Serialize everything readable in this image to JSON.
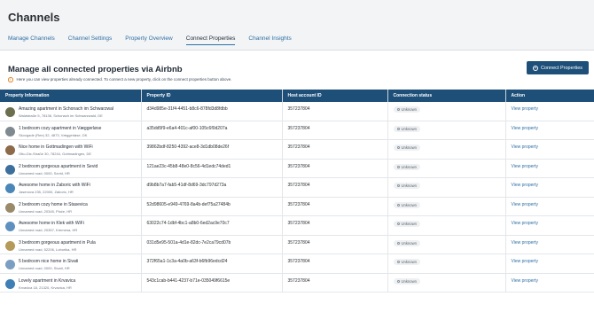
{
  "header": {
    "title": "Channels",
    "tabs": [
      {
        "label": "Manage Channels",
        "active": false
      },
      {
        "label": "Channel Settings",
        "active": false
      },
      {
        "label": "Property Overview",
        "active": false
      },
      {
        "label": "Connect Properties",
        "active": true
      },
      {
        "label": "Channel Insights",
        "active": false
      }
    ]
  },
  "section": {
    "title": "Manage all connected properties via Airbnb",
    "connect_button": "Connect Properties",
    "info": "Here you can view properties already connected. To connect a new property, click on the connect properties button above."
  },
  "table": {
    "columns": [
      "Property Information",
      "Property ID",
      "Host account ID",
      "Connection status",
      "Action"
    ],
    "rows": [
      {
        "name": "Amazing apartment in Schonach im Schwarzwal",
        "address": "Waldstraße 5, 78136, Schonach im Schwarzwald, DE",
        "property_id": "d34d985e-31f4-4451-b8c6-878fd3d8fdbb",
        "host_id": "357237804",
        "status": "Unknown",
        "action": "View property",
        "thumb": "#6b6f4e"
      },
      {
        "name": "1 bedroom cozy apartment in Væggerløse",
        "address": "Skovgade (Ree) 32, 4873, Væggerløse, DK",
        "property_id": "a35dd5f9-e6a4-401c-af00-105c6f0d207a",
        "host_id": "357237804",
        "status": "Unknown",
        "action": "View property",
        "thumb": "#7e8a8f"
      },
      {
        "name": "Nice home in Gottmadingen with WiFi",
        "address": "Otto-Dix-Straße 30, 78244, Gottmadingen, DE",
        "property_id": "39862bdf-8250-4392-ace8-3d1db08de26f",
        "host_id": "357237804",
        "status": "Unknown",
        "action": "View property",
        "thumb": "#8c6a4a"
      },
      {
        "name": "2 bedroom gorgeous apartment in Sevid",
        "address": "Unnamed road, 0000, Sevid, HR",
        "property_id": "121ae23c-45b8-48e0-8c56-4d1edc74ded1",
        "host_id": "357237804",
        "status": "Unknown",
        "action": "View property",
        "thumb": "#3d6f9c"
      },
      {
        "name": "Awesome home in Zaboric with WiFi",
        "address": "Jasenova 235, 22000, Zaboric, HR",
        "property_id": "d9b8b7a7-fab5-41df-8d69-3dc797d273a",
        "host_id": "357237804",
        "status": "Unknown",
        "action": "View property",
        "thumb": "#4a86b8"
      },
      {
        "name": "2 bedroom cozy home in Stasevica",
        "address": "Unnamed road, 20345, Ploče, HR",
        "property_id": "52d98605-e949-4769-8a4b-def75a27484b",
        "host_id": "357237804",
        "status": "Unknown",
        "action": "View property",
        "thumb": "#9a8a6a"
      },
      {
        "name": "Awesome home in Klek with WiFi",
        "address": "Unnamed road, 20357, Kremena, HR",
        "property_id": "63022c74-1dbf-4bc1-a8b0-6ed2ac9e70c7",
        "host_id": "357237804",
        "status": "Unknown",
        "action": "View property",
        "thumb": "#5f90bf"
      },
      {
        "name": "3 bedroom gorgeous apartment in Pula",
        "address": "Unnamed road, 52206, Loborika, HR",
        "property_id": "031d5e95-501a-4d1e-82dc-7e2ca79cd07b",
        "host_id": "357237804",
        "status": "Unknown",
        "action": "View property",
        "thumb": "#b59a5a"
      },
      {
        "name": "5 bedroom nice home in Sivati",
        "address": "Unnamed road, 0000, Sivati, HR",
        "property_id": "372f65a1-1c3a-4a0b-a63f-b6fb96edcd24",
        "host_id": "357237804",
        "status": "Unknown",
        "action": "View property",
        "thumb": "#7a9fc2"
      },
      {
        "name": "Lovely apartment in Krvavica",
        "address": "Krvavica 18, 21320, Krvavica, HR",
        "property_id": "543c1cab-b441-4237-b71e-035049f6615e",
        "host_id": "357237804",
        "status": "Unknown",
        "action": "View property",
        "thumb": "#3f7fb5"
      }
    ]
  }
}
